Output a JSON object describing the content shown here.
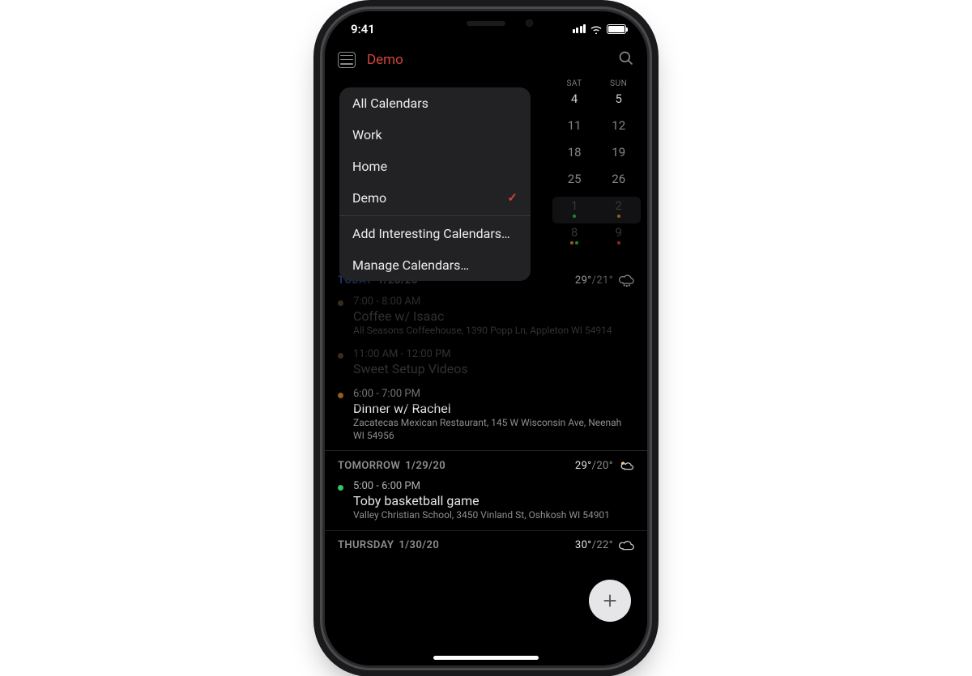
{
  "status": {
    "time": "9:41"
  },
  "nav": {
    "title": "Demo"
  },
  "popover": {
    "items": [
      {
        "label": "All Calendars",
        "selected": false
      },
      {
        "label": "Work",
        "selected": false
      },
      {
        "label": "Home",
        "selected": false
      },
      {
        "label": "Demo",
        "selected": true
      }
    ],
    "actions": [
      {
        "label": "Add Interesting Calendars…"
      },
      {
        "label": "Manage Calendars…"
      }
    ]
  },
  "weekdays": {
    "sat": "SAT",
    "sun": "SUN"
  },
  "mini_dates": {
    "r0": [
      "4",
      "5"
    ],
    "r1": [
      "11",
      "12"
    ],
    "r2": [
      "18",
      "19"
    ],
    "r3": [
      "25",
      "26"
    ],
    "r4": [
      "1",
      "2"
    ],
    "r5": [
      "8",
      "9"
    ]
  },
  "days": [
    {
      "label": "TODAY",
      "date": "1/28/20",
      "today": true,
      "hi": "29°",
      "lo": "/21°",
      "icon": "cloud-snow",
      "events": [
        {
          "time": "7:00 - 8:00 AM",
          "title": "Coffee w/ Isaac",
          "loc": "All Seasons Coffeehouse, 1390 Popp Ln, Appleton WI 54914",
          "color": "#b58a3f",
          "dim": true
        },
        {
          "time": "11:00 AM - 12:00 PM",
          "title": "Sweet Setup Videos",
          "loc": "",
          "color": "#b58a3f",
          "dim": true
        },
        {
          "time": "6:00 - 7:00 PM",
          "title": "Dinner w/ Rachel",
          "loc": "Zacatecas Mexican Restaurant, 145 W Wisconsin Ave, Neenah WI 54956",
          "color": "#e0912c",
          "dim": false
        }
      ]
    },
    {
      "label": "TOMORROW",
      "date": "1/29/20",
      "today": false,
      "hi": "29°",
      "lo": "/20°",
      "icon": "partly-cloudy",
      "events": [
        {
          "time": "5:00 - 6:00 PM",
          "title": "Toby basketball game",
          "loc": "Valley Christian School, 3450 Vinland St, Oshkosh WI 54901",
          "color": "#34c759",
          "dim": false
        }
      ]
    },
    {
      "label": "THURSDAY",
      "date": "1/30/20",
      "today": false,
      "hi": "30°",
      "lo": "/22°",
      "icon": "cloud",
      "events": []
    }
  ],
  "colors": {
    "accent": "#d1453b",
    "today": "#3f6fd8"
  }
}
